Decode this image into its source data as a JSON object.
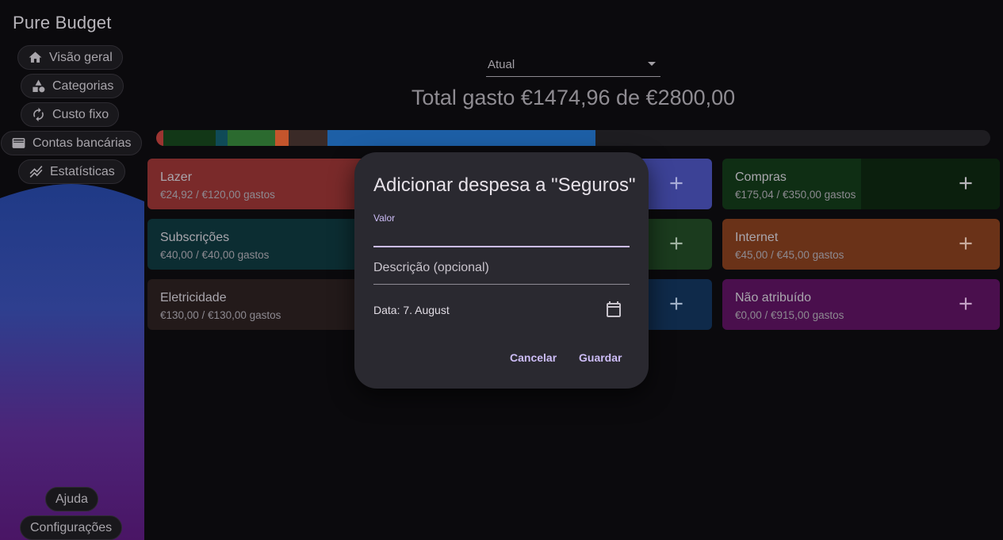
{
  "app": {
    "title": "Pure Budget"
  },
  "nav": {
    "overview": "Visão geral",
    "categories": "Categorias",
    "fixed_cost": "Custo fixo",
    "bank_accounts": "Contas bancárias",
    "statistics": "Estatísticas",
    "help": "Ajuda",
    "settings": "Configurações"
  },
  "period": {
    "selected": "Atual"
  },
  "summary": {
    "total_text": "Total gasto €1474,96 de €2800,00",
    "spent": 1474.96,
    "budget": 2800.0
  },
  "progress_segments": [
    {
      "color": "#9c3431",
      "value": 24.92
    },
    {
      "color": "#123717",
      "value": 175.04
    },
    {
      "color": "#0f4a57",
      "value": 40.0
    },
    {
      "color": "#2b6a2f",
      "value": 160.0
    },
    {
      "color": "#c4552c",
      "value": 45.0
    },
    {
      "color": "#3a2a27",
      "value": 130.0
    },
    {
      "color": "#1d5fa6",
      "value": 900.0
    }
  ],
  "categories": [
    {
      "name": "Lazer",
      "amount": "€24,92 / €120,00 gastos",
      "color": "#7a2a2a"
    },
    {
      "name": "Compras",
      "amount": "€175,04 / €350,00 gastos",
      "color": "#0f2e14"
    },
    {
      "name": "Subscrições",
      "amount": "€40,00 / €40,00 gastos",
      "color": "#0c2d32"
    },
    {
      "name": "Internet",
      "amount": "€45,00 / €45,00 gastos",
      "color": "#6a3218"
    },
    {
      "name": "Eletricidade",
      "amount": "€130,00 / €130,00 gastos",
      "color": "#231a1a"
    },
    {
      "name": "Não atribuído",
      "amount": "€0,00 / €915,00 gastos",
      "color": "#4a0f4d"
    }
  ],
  "dialog": {
    "title": "Adicionar despesa a \"Seguros\"",
    "value_label": "Valor",
    "value": "",
    "description_placeholder": "Descrição (opcional)",
    "date_text": "Data: 7. August",
    "cancel_label": "Cancelar",
    "save_label": "Guardar"
  },
  "colors": {
    "accent": "#cdbdf7",
    "dialog_bg": "#2a2930"
  }
}
